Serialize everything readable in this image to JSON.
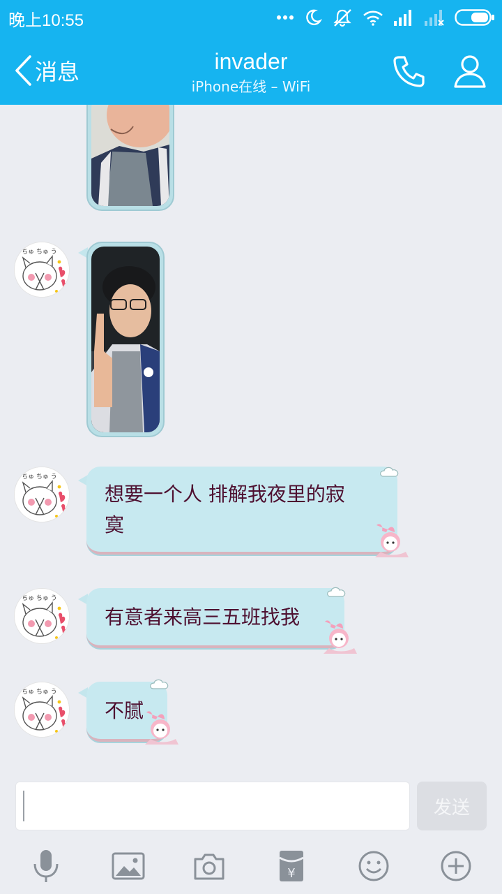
{
  "status_bar": {
    "time": "晚上10:55",
    "icons": [
      "more-dots-icon",
      "moon-icon",
      "mute-icon",
      "wifi-icon",
      "signal-icon",
      "signal-off-icon",
      "battery-icon"
    ]
  },
  "header": {
    "back_label": "消息",
    "contact_name": "invader",
    "contact_status": "iPhone在线 – WiFi",
    "icons": [
      "phone-icon",
      "profile-icon"
    ],
    "color": "#16b4f0"
  },
  "messages": [
    {
      "type": "image",
      "content": "selfie photo (partially scrolled)"
    },
    {
      "type": "image",
      "content": "selfie photo"
    },
    {
      "type": "text",
      "lines": [
        "想要一个人 排解我夜里的寂",
        "寞"
      ]
    },
    {
      "type": "text",
      "lines": [
        "有意者来高三五班找我"
      ]
    },
    {
      "type": "text",
      "lines": [
        "不腻"
      ]
    }
  ],
  "input": {
    "placeholder": "",
    "send_label": "发送"
  },
  "toolbar": [
    "microphone-icon",
    "image-icon",
    "camera-icon",
    "red-packet-icon",
    "emoji-icon",
    "plus-icon"
  ]
}
